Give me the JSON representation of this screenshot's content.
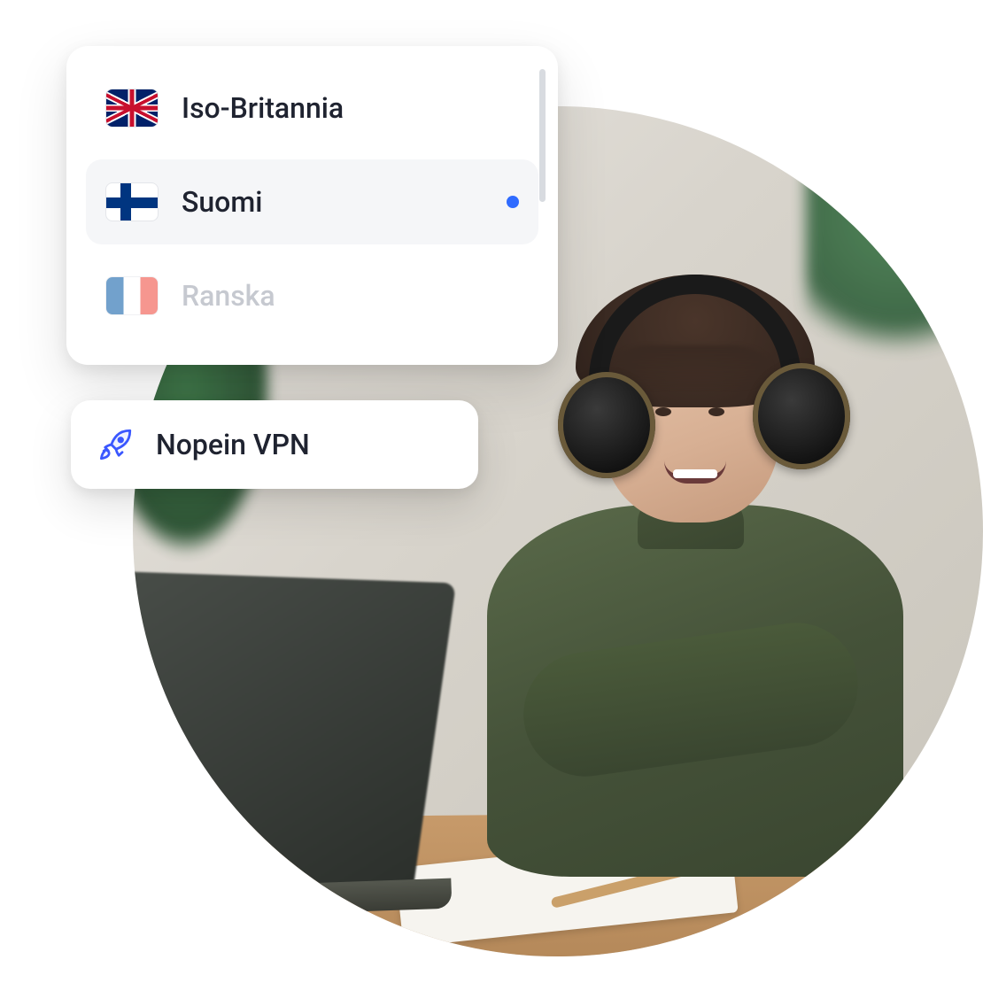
{
  "countries": [
    {
      "name": "Iso-Britannia",
      "flag": "uk",
      "selected": false,
      "faded": false
    },
    {
      "name": "Suomi",
      "flag": "fi",
      "selected": true,
      "faded": false
    },
    {
      "name": "Ranska",
      "flag": "fr",
      "selected": false,
      "faded": true
    }
  ],
  "fastest_vpn": {
    "label": "Nopein VPN",
    "icon": "rocket-icon"
  },
  "colors": {
    "accent": "#2f6bff"
  }
}
